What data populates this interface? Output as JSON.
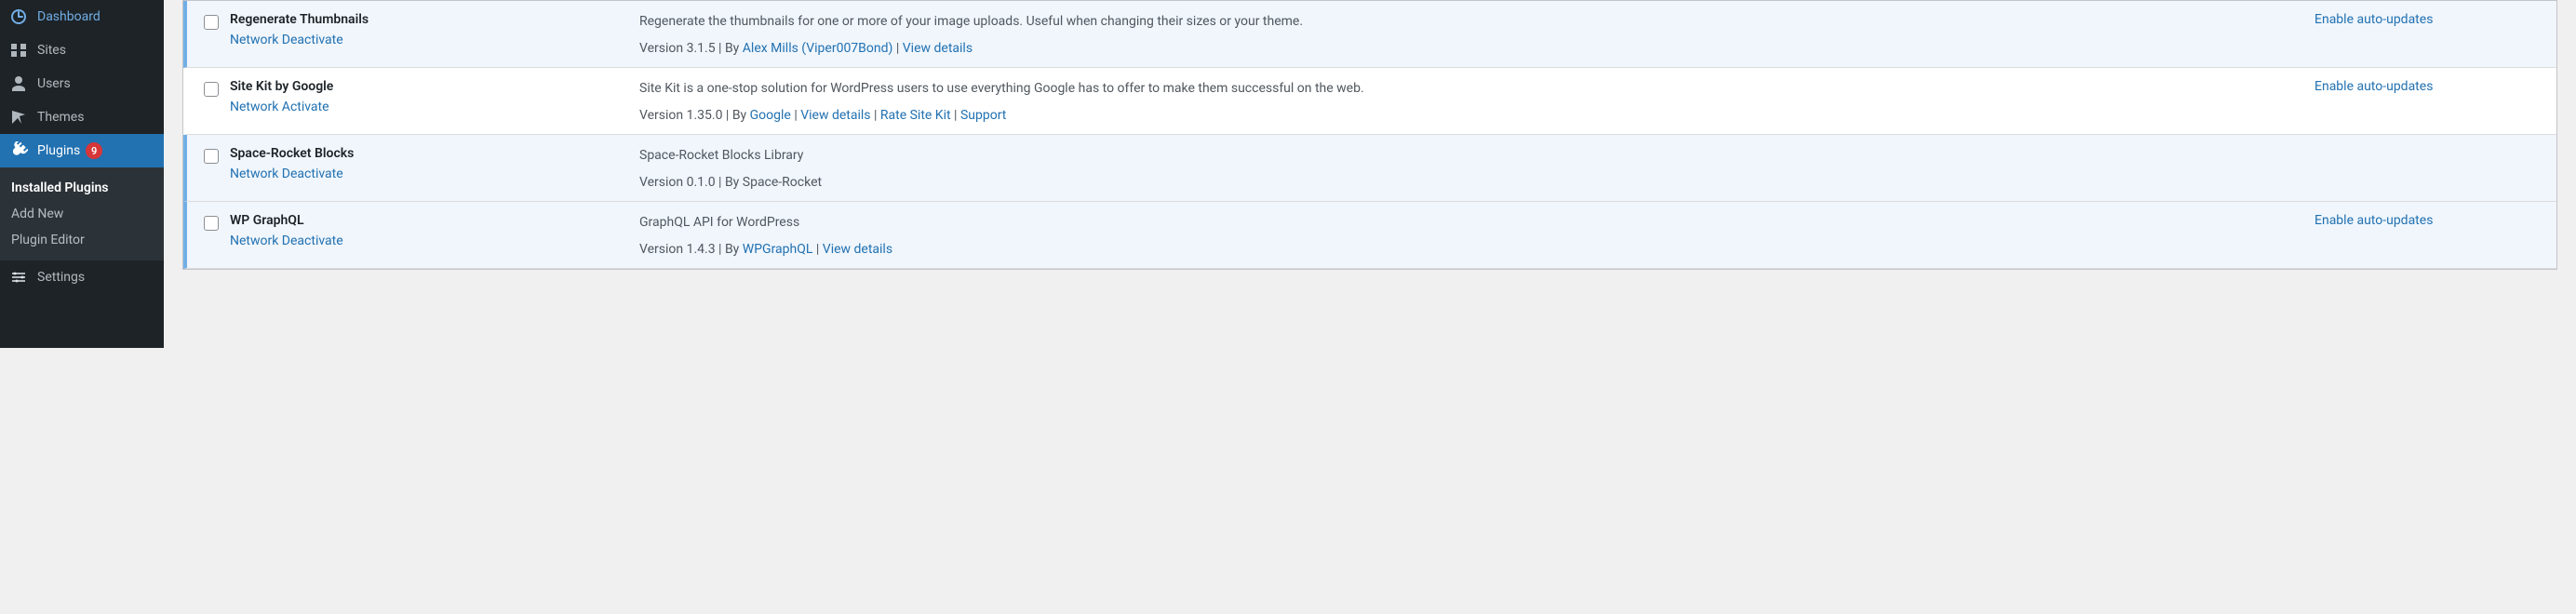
{
  "sidebar": {
    "items": [
      {
        "label": "Dashboard"
      },
      {
        "label": "Sites"
      },
      {
        "label": "Users"
      },
      {
        "label": "Themes"
      },
      {
        "label": "Plugins",
        "badge": "9"
      },
      {
        "label": "Settings"
      }
    ],
    "submenu": {
      "items": [
        {
          "label": "Installed Plugins"
        },
        {
          "label": "Add New"
        },
        {
          "label": "Plugin Editor"
        }
      ]
    }
  },
  "plugins": [
    {
      "name": "Regenerate Thumbnails",
      "action": "Network Deactivate",
      "description": "Regenerate the thumbnails for one or more of your image uploads. Useful when changing their sizes or your theme.",
      "version_prefix": "Version 3.1.5 | By ",
      "author": "Alex Mills (Viper007Bond)",
      "links": [
        {
          "label": "View details"
        }
      ],
      "auto_update": "Enable auto-updates"
    },
    {
      "name": "Site Kit by Google",
      "action": "Network Activate",
      "description": "Site Kit is a one-stop solution for WordPress users to use everything Google has to offer to make them successful on the web.",
      "version_prefix": "Version 1.35.0 | By ",
      "author": "Google",
      "links": [
        {
          "label": "View details"
        },
        {
          "label": "Rate Site Kit"
        },
        {
          "label": "Support"
        }
      ],
      "auto_update": "Enable auto-updates"
    },
    {
      "name": "Space-Rocket Blocks",
      "action": "Network Deactivate",
      "description": "Space-Rocket Blocks Library",
      "version_full": "Version 0.1.0 | By Space-Rocket",
      "links": [],
      "auto_update": ""
    },
    {
      "name": "WP GraphQL",
      "action": "Network Deactivate",
      "description": "GraphQL API for WordPress",
      "version_prefix": "Version 1.4.3 | By ",
      "author": "WPGraphQL",
      "links": [
        {
          "label": "View details"
        }
      ],
      "auto_update": "Enable auto-updates"
    }
  ]
}
